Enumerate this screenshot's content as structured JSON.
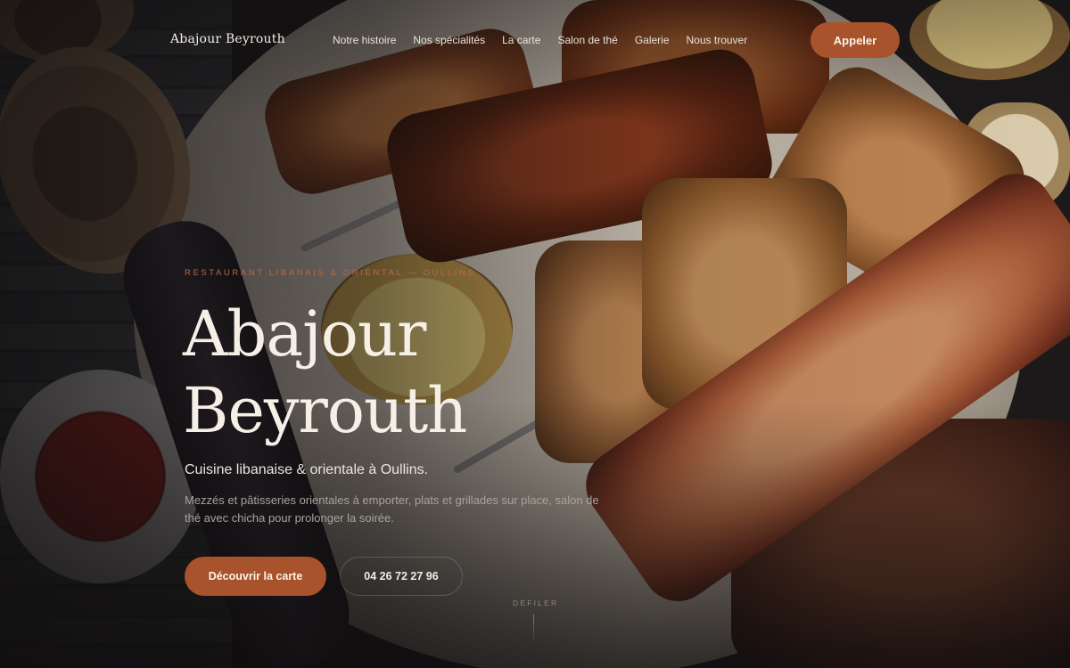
{
  "brand": {
    "name": "Abajour Beyrouth"
  },
  "nav": {
    "items": [
      {
        "label": "Notre histoire"
      },
      {
        "label": "Nos spécialités"
      },
      {
        "label": "La carte"
      },
      {
        "label": "Salon de thé"
      },
      {
        "label": "Galerie"
      },
      {
        "label": "Nous trouver"
      }
    ],
    "call_label": "Appeler"
  },
  "hero": {
    "eyebrow": "RESTAURANT LIBANAIS & ORIENTAL — OULLINS",
    "title_line1": "Abajour",
    "title_line2": "Beyrouth",
    "subtitle": "Cuisine libanaise & orientale à Oullins.",
    "description": "Mezzés et pâtisseries orientales à emporter, plats et grillades sur place, salon de thé avec chicha pour prolonger la soirée.",
    "cta_label": "Découvrir la carte",
    "phone": "04 26 72 27 96",
    "scroll_label": "DÉFILER"
  },
  "colors": {
    "accent": "#a8532c",
    "eyebrow": "#b86a45",
    "text_light": "#f5efe6"
  }
}
